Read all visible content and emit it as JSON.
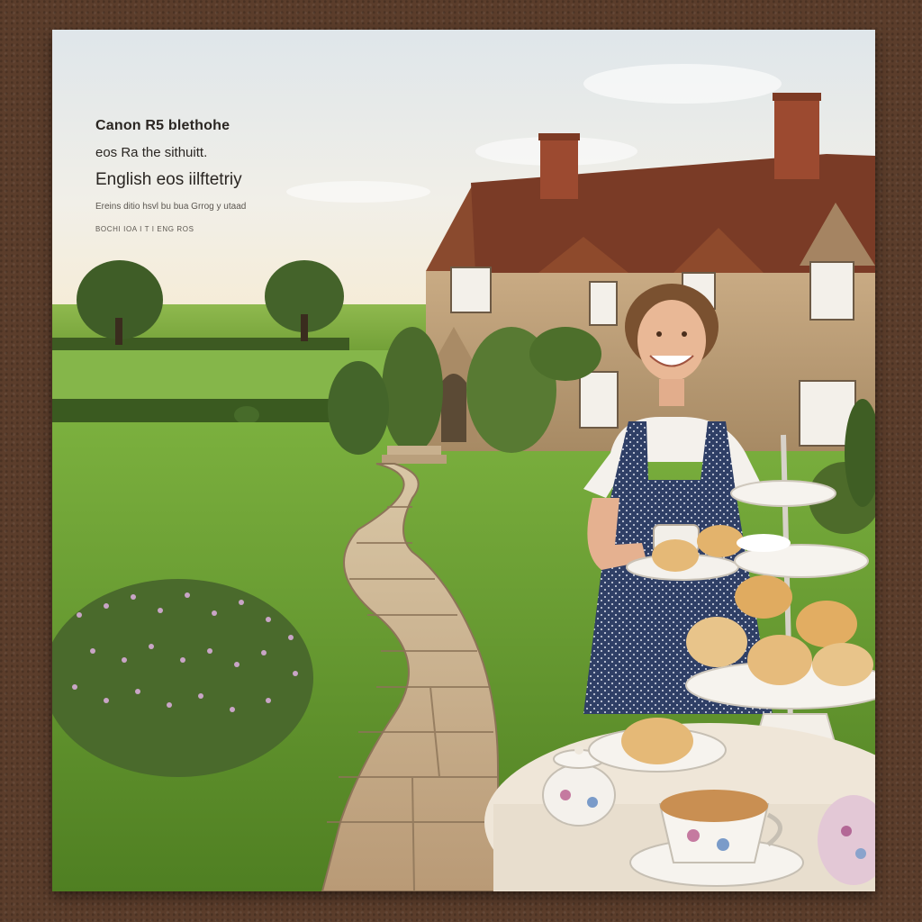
{
  "caption": {
    "line1": "Canon R5 blethohe",
    "line2": "eos Ra the sithuitt.",
    "line3": "English eos iilftetriy",
    "line4": "Ereins ditio hsvl bu bua Grrog y utaad",
    "line5": "BOCHI IOA I T I ENG ROS"
  },
  "colors": {
    "background": "#5b3d2b",
    "sky": "#e9ece8",
    "lawn": "#6fa33a",
    "house_stone": "#b89a74",
    "roof": "#7a3b26",
    "dress": "#2f3f66",
    "path": "#c8b08e"
  }
}
